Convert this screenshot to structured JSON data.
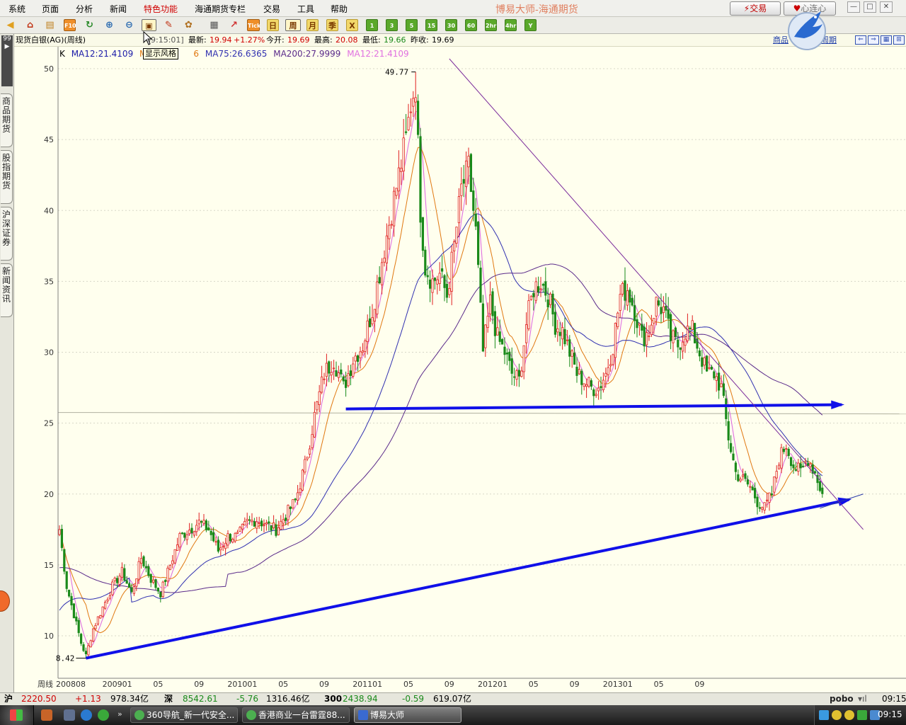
{
  "menu": {
    "items": [
      "系统",
      "页面",
      "分析",
      "新闻",
      "特色功能",
      "海通期货专栏",
      "交易",
      "工具",
      "帮助"
    ],
    "active_index": 4,
    "title": "博易大师-海通期货",
    "trade_button": "交易",
    "service_button": "心连心"
  },
  "toolbar": {
    "tooltip": "显示风格",
    "period_buttons": [
      "日",
      "周",
      "月",
      "季",
      "X",
      "1",
      "3",
      "5",
      "15",
      "30",
      "60",
      "2hr",
      "4hr",
      "Y"
    ],
    "active_period": "周",
    "tick_label": "Tick",
    "f10_label": "F10"
  },
  "infobar": {
    "instrument": "现货白银(AG)(周线)",
    "time": "09:15:01]",
    "latest_label": "最新:",
    "latest": "19.94",
    "change": "+1.27%",
    "open_label": "今开:",
    "open": "19.69",
    "high_label": "最高:",
    "high": "20.08",
    "low_label": "最低:",
    "low": "19.66",
    "prev_label": "昨收:",
    "prev": "19.69",
    "right_link1": "商品",
    "right_link2": "周期"
  },
  "sidetabs": {
    "top": "99",
    "tabs": [
      "商品期货",
      "股指期货",
      "沪深证券",
      "新闻资讯"
    ]
  },
  "chart_data": {
    "type": "candlestick",
    "title": "现货白银(AG)(周线)",
    "period": "周线",
    "ylim": [
      7,
      52
    ],
    "y_ticks": [
      10,
      15,
      20,
      25,
      30,
      35,
      40,
      45,
      50
    ],
    "x_tick_labels": [
      "200808",
      "200901",
      "05",
      "09",
      "201001",
      "05",
      "09",
      "201101",
      "05",
      "09",
      "201201",
      "05",
      "09",
      "201301",
      "05",
      "09"
    ],
    "x_axis_label": "周线",
    "grid": true,
    "legend": [
      {
        "name": "K",
        "color": "#000000"
      },
      {
        "name": "MA12:21.4109",
        "color": "#1a1aa8"
      },
      {
        "name": "MA",
        "color": "#e07810"
      },
      {
        "name": "6",
        "color": "#e07810"
      },
      {
        "name": "MA75:26.6365",
        "color": "#3030b0"
      },
      {
        "name": "MA200:27.9999",
        "color": "#5a2a8a"
      },
      {
        "name": "MA12:21.4109",
        "color": "#e070e0"
      }
    ],
    "annotations": [
      {
        "text": "49.77",
        "week": 148,
        "value": 49.77
      },
      {
        "text": "8.42",
        "week": 11,
        "value": 8.42
      }
    ],
    "anchors": [
      [
        0,
        17.5
      ],
      [
        3,
        13.5
      ],
      [
        6,
        11.5
      ],
      [
        9,
        9.5
      ],
      [
        11,
        8.6
      ],
      [
        14,
        10.5
      ],
      [
        18,
        12.0
      ],
      [
        22,
        13.5
      ],
      [
        26,
        14.5
      ],
      [
        30,
        13.0
      ],
      [
        34,
        15.5
      ],
      [
        38,
        14.0
      ],
      [
        42,
        13.0
      ],
      [
        46,
        15.0
      ],
      [
        50,
        17.0
      ],
      [
        54,
        17.5
      ],
      [
        58,
        18.0
      ],
      [
        62,
        17.5
      ],
      [
        66,
        16.0
      ],
      [
        70,
        17.0
      ],
      [
        74,
        17.0
      ],
      [
        78,
        18.0
      ],
      [
        82,
        18.2
      ],
      [
        86,
        17.8
      ],
      [
        90,
        17.5
      ],
      [
        94,
        18.5
      ],
      [
        98,
        19.5
      ],
      [
        102,
        22.0
      ],
      [
        106,
        25.5
      ],
      [
        110,
        28.5
      ],
      [
        114,
        29.5
      ],
      [
        118,
        27.5
      ],
      [
        122,
        29.5
      ],
      [
        126,
        30.5
      ],
      [
        130,
        33.0
      ],
      [
        134,
        36.5
      ],
      [
        138,
        40.0
      ],
      [
        141,
        42.5
      ],
      [
        144,
        45.0
      ],
      [
        146,
        47.5
      ],
      [
        148,
        49.0
      ],
      [
        150,
        40.0
      ],
      [
        152,
        36.0
      ],
      [
        155,
        35.0
      ],
      [
        158,
        35.5
      ],
      [
        161,
        34.0
      ],
      [
        164,
        37.5
      ],
      [
        167,
        41.5
      ],
      [
        170,
        43.0
      ],
      [
        173,
        38.5
      ],
      [
        176,
        30.0
      ],
      [
        179,
        33.5
      ],
      [
        182,
        31.0
      ],
      [
        185,
        30.0
      ],
      [
        188,
        28.5
      ],
      [
        191,
        28.0
      ],
      [
        194,
        32.0
      ],
      [
        197,
        34.5
      ],
      [
        200,
        35.0
      ],
      [
        203,
        34.0
      ],
      [
        206,
        32.0
      ],
      [
        209,
        31.5
      ],
      [
        212,
        30.0
      ],
      [
        215,
        28.5
      ],
      [
        218,
        28.0
      ],
      [
        221,
        27.5
      ],
      [
        224,
        27.5
      ],
      [
        227,
        28.5
      ],
      [
        230,
        30.5
      ],
      [
        233,
        34.0
      ],
      [
        236,
        34.5
      ],
      [
        239,
        33.0
      ],
      [
        242,
        31.0
      ],
      [
        245,
        31.5
      ],
      [
        248,
        33.5
      ],
      [
        251,
        33.0
      ],
      [
        254,
        31.0
      ],
      [
        257,
        30.5
      ],
      [
        260,
        31.5
      ],
      [
        263,
        31.5
      ],
      [
        266,
        30.0
      ],
      [
        269,
        28.5
      ],
      [
        272,
        28.5
      ],
      [
        275,
        27.5
      ],
      [
        278,
        24.0
      ],
      [
        281,
        21.5
      ],
      [
        284,
        21.0
      ],
      [
        287,
        20.5
      ],
      [
        290,
        19.5
      ],
      [
        293,
        19.0
      ],
      [
        296,
        20.0
      ],
      [
        299,
        22.5
      ],
      [
        302,
        23.5
      ],
      [
        305,
        22.0
      ],
      [
        308,
        21.5
      ],
      [
        311,
        22.5
      ],
      [
        314,
        21.5
      ],
      [
        317,
        20.0
      ]
    ],
    "drawn_lines": [
      {
        "name": "support-line",
        "color": "#1010e8",
        "from": {
          "week": 11,
          "value": 8.42
        },
        "to": {
          "week": 328,
          "value": 19.6
        }
      },
      {
        "name": "neckline",
        "color": "#1010e8",
        "from": {
          "week": 119,
          "value": 26.0
        },
        "to": {
          "week": 325,
          "value": 26.3
        }
      },
      {
        "name": "downtrend-line",
        "color": "#7a2a9a",
        "from": {
          "week": 162,
          "value": 50.7
        },
        "to": {
          "week": 334,
          "value": 17.5
        }
      },
      {
        "name": "trend-extension",
        "color": "#2a3aa8",
        "from": {
          "week": 316,
          "value": 19.0
        },
        "to": {
          "week": 334,
          "value": 20.0
        }
      }
    ]
  },
  "statusbar": {
    "sh_label": "沪",
    "sh_index": "2220.50",
    "sh_change": "+1.13",
    "sh_amount": "978.34亿",
    "sz_label": "深",
    "sz_index": "8542.61",
    "sz_change": "-5.76",
    "sz_amount": "1316.46亿",
    "hs_label": "300",
    "hs_index": "2438.94",
    "hs_change": "-0.59",
    "hs_amount": "619.07亿",
    "brand": "pobo",
    "time": "09:15"
  },
  "taskbar": {
    "tasks": [
      "360导航_新一代安全...",
      "香港商业一台雷霆88...",
      "博易大师"
    ],
    "active_index": 2,
    "clock": "09:15"
  },
  "colors": {
    "chart_bg": "#ffffee",
    "up_candle": "#e02020",
    "down_candle": "#1a8a1a",
    "grid": "#d8d8c8"
  }
}
